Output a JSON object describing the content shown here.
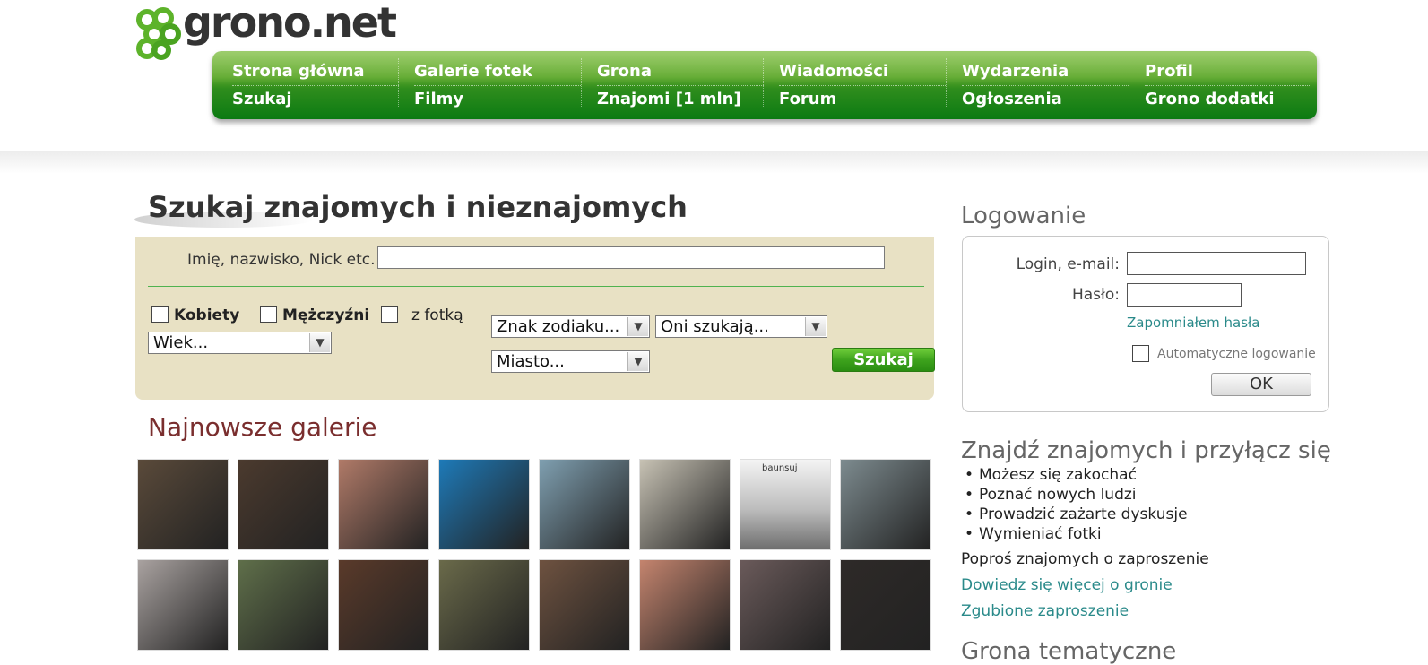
{
  "logo": {
    "text": "grono.net"
  },
  "nav": {
    "columns": [
      {
        "top": "Strona główna",
        "bottom": "Szukaj"
      },
      {
        "top": "Galerie fotek",
        "bottom": "Filmy"
      },
      {
        "top": "Grona",
        "bottom": "Znajomi [1 mln]"
      },
      {
        "top": "Wiadomości",
        "bottom": "Forum"
      },
      {
        "top": "Wydarzenia",
        "bottom": "Ogłoszenia"
      },
      {
        "top": "Profil",
        "bottom": "Grono dodatki"
      }
    ]
  },
  "search": {
    "title": "Szukaj znajomych i nieznajomych",
    "name_label": "Imię, nazwisko, Nick etc.",
    "name_value": "",
    "women_label": "Kobiety",
    "men_label": "Mężczyźni",
    "photo_label": "z fotką",
    "age_select": "Wiek...",
    "zodiac_select": "Znak zodiaku...",
    "looking_select": "Oni szukają...",
    "city_select": "Miasto...",
    "submit_label": "Szukaj"
  },
  "galleries": {
    "title": "Najnowsze galerie",
    "thumbs_row1": [
      "#5a4a3a",
      "#4b3a2e",
      "#b07a68",
      "#1e7ab8",
      "#7f9fb0",
      "#c7c2b4",
      "#a4a4a4",
      "#7d8b8f"
    ],
    "thumbs_row2": [
      "#a9a2a0",
      "#5f6f4a",
      "#5a3a2a",
      "#6a6a4a",
      "#6e5240",
      "#c4846e",
      "#6a5a5a",
      "#2e2a28"
    ],
    "thumb_caption": "baunsuj"
  },
  "login": {
    "title": "Logowanie",
    "login_label": "Login, e-mail:",
    "password_label": "Hasło:",
    "forgot_link": "Zapomniałem hasła",
    "auto_label": "Automatyczne logowanie",
    "ok_label": "OK"
  },
  "join": {
    "title": "Znajdź znajomych i przyłącz się",
    "items": [
      "Możesz się zakochać",
      "Poznać nowych ludzi",
      "Prowadzić zażarte dyskusje",
      "Wymieniać fotki"
    ],
    "ask": "Poproś znajomych o zaproszenie",
    "more_link": "Dowiedz się więcej o gronie",
    "lost_link": "Zgubione zaproszenie"
  },
  "grona": {
    "title": "Grona tematyczne"
  },
  "colors": {
    "nav_green": "#2f8d1d",
    "search_bg": "#e8e1c4",
    "link": "#2a8a8a",
    "gallery_title": "#7a2e2e"
  }
}
